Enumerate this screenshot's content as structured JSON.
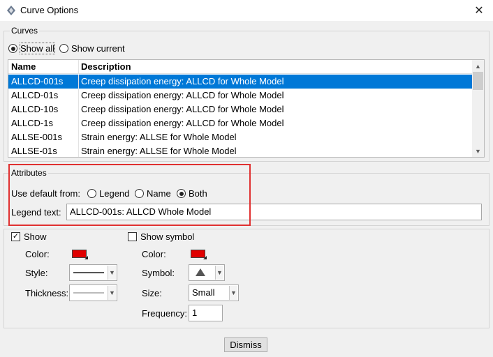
{
  "window": {
    "title": "Curve Options",
    "app_icon": "abaqus-icon",
    "close_icon": "close-icon"
  },
  "curves": {
    "group_label": "Curves",
    "show_all_label": "Show all",
    "show_current_label": "Show current",
    "selected_option": "Show all",
    "columns": {
      "name": "Name",
      "description": "Description"
    },
    "rows": [
      {
        "name": "ALLCD-001s",
        "description": "Creep dissipation energy: ALLCD for Whole Model",
        "selected": true
      },
      {
        "name": "ALLCD-01s",
        "description": "Creep dissipation energy: ALLCD for Whole Model",
        "selected": false
      },
      {
        "name": "ALLCD-10s",
        "description": "Creep dissipation energy: ALLCD for Whole Model",
        "selected": false
      },
      {
        "name": "ALLCD-1s",
        "description": "Creep dissipation energy: ALLCD for Whole Model",
        "selected": false
      },
      {
        "name": "ALLSE-001s",
        "description": "Strain energy: ALLSE for Whole Model",
        "selected": false
      },
      {
        "name": "ALLSE-01s",
        "description": "Strain energy: ALLSE for Whole Model",
        "selected": false
      }
    ]
  },
  "attributes": {
    "group_label": "Attributes",
    "use_default_label": "Use default from:",
    "legend_label": "Legend",
    "name_label": "Name",
    "both_label": "Both",
    "selected_option": "Both",
    "legend_text_label": "Legend text:",
    "legend_text_value": "ALLCD-001s: ALLCD Whole Model"
  },
  "line": {
    "show_label": "Show",
    "show_checked": true,
    "color_label": "Color:",
    "color_value": "#e00000",
    "style_label": "Style:",
    "style_value": "solid",
    "thickness_label": "Thickness:",
    "thickness_value": "thin"
  },
  "symbol": {
    "show_symbol_label": "Show symbol",
    "show_symbol_checked": false,
    "color_label": "Color:",
    "color_value": "#e00000",
    "symbol_label": "Symbol:",
    "symbol_value": "triangle",
    "size_label": "Size:",
    "size_value": "Small",
    "frequency_label": "Frequency:",
    "frequency_value": "1"
  },
  "footer": {
    "dismiss_label": "Dismiss"
  },
  "colors": {
    "selection": "#0078d7",
    "highlight_box": "#e03030"
  }
}
